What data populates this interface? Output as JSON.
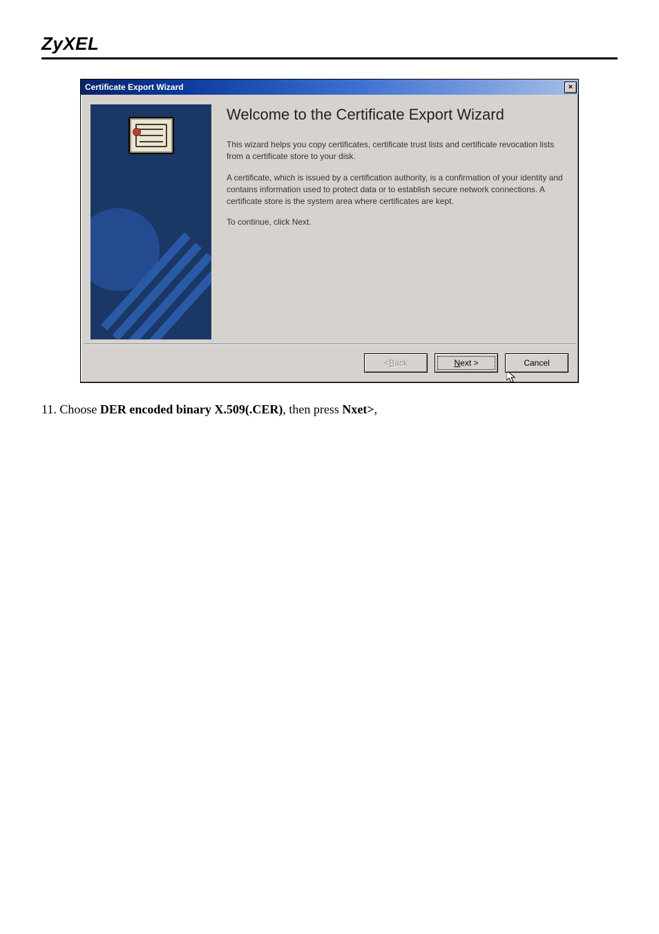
{
  "brand": "ZyXEL",
  "dialog": {
    "title": "Certificate Export Wizard",
    "close_glyph": "×",
    "heading": "Welcome to the Certificate Export Wizard",
    "para1": "This wizard helps you copy certificates, certificate trust lists and certificate revocation lists from a certificate store to your disk.",
    "para2": "A certificate, which is issued by a certification authority, is a confirmation of your identity and contains information used to protect data or to establish secure network connections. A certificate store is the system area where certificates are kept.",
    "para3": "To continue, click Next.",
    "buttons": {
      "back_prefix": "< ",
      "back_mnemonic": "B",
      "back_rest": "ack",
      "next_mnemonic": "N",
      "next_rest": "ext >",
      "cancel": "Cancel"
    }
  },
  "instruction": {
    "number": "11. ",
    "lead": "Choose ",
    "bold1": "DER encoded binary X.509(.CER)",
    "mid": ", then press ",
    "bold2": "Nxet>",
    "tail": ","
  }
}
